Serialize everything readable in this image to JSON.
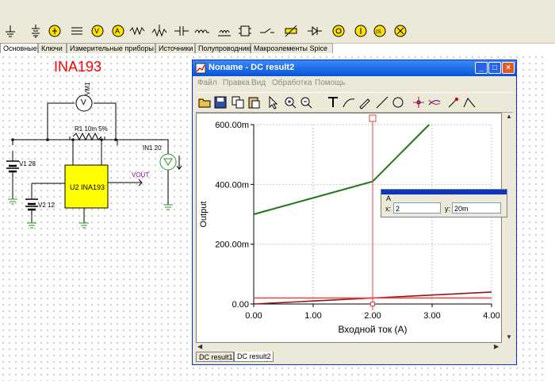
{
  "component_tabs": [
    {
      "label": "Основные",
      "active": true
    },
    {
      "label": "Ключи"
    },
    {
      "label": "Измерительные приборы"
    },
    {
      "label": "Источники"
    },
    {
      "label": "Полупроводники"
    },
    {
      "label": "Макроэлементы Spice"
    }
  ],
  "toolbar_icons": [
    "ground-icon",
    "battery-icon",
    "voltage-source-icon",
    "current-source-icon",
    "voltmeter-icon",
    "ammeter-icon",
    "resistor-icon",
    "potentiometer-icon",
    "capacitor-icon",
    "inductor-icon",
    "transformer-icon",
    "relay-icon",
    "switch-icon",
    "variable-resistor-icon",
    "diode-icon",
    "voltage-pin-icon",
    "current-pin-icon",
    "led-icon",
    "lamp-icon"
  ],
  "schematic": {
    "title": "INA193",
    "labels": {
      "vm1": "VM1",
      "r1": "R1 10m 5%",
      "v1": "V1 28",
      "v2": "V2 12",
      "in1": "IN1 20",
      "u2": "U2 INA193",
      "vout": "VOUT",
      "voltmeter_symbol": "V"
    }
  },
  "dc_window": {
    "title": "Noname - DC result2",
    "menu": [
      "Файл",
      "Правка",
      "Вид",
      "Обработка",
      "Помощь"
    ],
    "result_tabs": [
      {
        "label": "DC result1"
      },
      {
        "label": "DC result2",
        "active": true
      }
    ],
    "cursor": {
      "name": "A",
      "x_label": "x:",
      "x_value": "2",
      "y_label": "y:",
      "y_value": "20m"
    }
  },
  "chart_data": {
    "type": "line",
    "xlabel": "Входной ток (A)",
    "ylabel": "Output",
    "xlim": [
      0,
      4
    ],
    "ylim": [
      0,
      0.6
    ],
    "x_ticks": [
      0,
      1,
      2,
      3,
      4
    ],
    "x_tick_labels": [
      "0.00",
      "1.00",
      "2.00",
      "3.00",
      "4.00"
    ],
    "y_ticks": [
      0,
      0.2,
      0.4,
      0.6
    ],
    "y_tick_labels": [
      "0.00",
      "200.00m",
      "400.00m",
      "600.00m"
    ],
    "grid": true,
    "cursor_x": 2,
    "series": [
      {
        "color": "#1a7a1a",
        "x": [
          0,
          2,
          2.95
        ],
        "y": [
          0.3,
          0.41,
          0.6
        ]
      },
      {
        "color": "#8b1a1a",
        "x": [
          0,
          2,
          4
        ],
        "y": [
          0,
          0.02,
          0.04
        ]
      },
      {
        "color": "#e05050",
        "x": [
          0,
          4
        ],
        "y": [
          0.02,
          0.02
        ]
      }
    ]
  }
}
